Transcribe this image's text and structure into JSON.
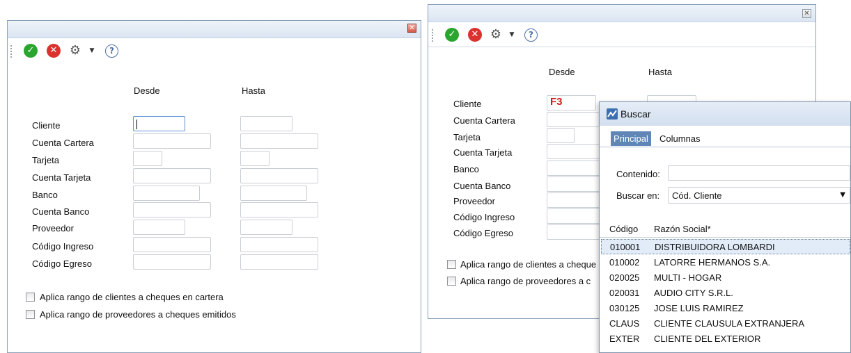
{
  "left_form": {
    "close_icon": "close-x-red",
    "toolbar": {
      "accept_icon": "check-circle-icon",
      "cancel_icon": "cancel-circle-icon",
      "settings_icon": "gear-icon",
      "dropdown_icon": "chevron-down-icon",
      "help_icon": "help-icon"
    },
    "col_desde": "Desde",
    "col_hasta": "Hasta",
    "fields": [
      {
        "label": "Cliente"
      },
      {
        "label": "Cuenta Cartera"
      },
      {
        "label": "Tarjeta"
      },
      {
        "label": "Cuenta Tarjeta"
      },
      {
        "label": "Banco"
      },
      {
        "label": "Cuenta Banco"
      },
      {
        "label": "Proveedor"
      },
      {
        "label": "Código Ingreso"
      },
      {
        "label": "Código Egreso"
      }
    ],
    "checkboxes": [
      {
        "label": "Aplica rango de clientes a cheques en cartera",
        "checked": false
      },
      {
        "label": "Aplica rango de proveedores a cheques emitidos",
        "checked": false
      }
    ]
  },
  "right_form": {
    "col_desde": "Desde",
    "col_hasta": "Hasta",
    "hint_key": "F3",
    "fields": [
      {
        "label": "Cliente"
      },
      {
        "label": "Cuenta Cartera"
      },
      {
        "label": "Tarjeta"
      },
      {
        "label": "Cuenta Tarjeta"
      },
      {
        "label": "Banco"
      },
      {
        "label": "Cuenta Banco"
      },
      {
        "label": "Proveedor"
      },
      {
        "label": "Código Ingreso"
      },
      {
        "label": "Código Egreso"
      }
    ],
    "checkboxes": [
      {
        "label": "Aplica rango de clientes a cheque",
        "checked": false
      },
      {
        "label": "Aplica rango de proveedores a c",
        "checked": false
      }
    ]
  },
  "search_dialog": {
    "title": "Buscar",
    "title_icon": "chart-app-icon",
    "tabs": [
      {
        "label": "Principal",
        "active": true
      },
      {
        "label": "Columnas",
        "active": false
      }
    ],
    "contenido_label": "Contenido:",
    "contenido_value": "",
    "buscar_en_label": "Buscar en:",
    "buscar_en_value": "Cód. Cliente",
    "columns": [
      "Código",
      "Razón Social*"
    ],
    "rows": [
      {
        "code": "010001",
        "name": "DISTRIBUIDORA LOMBARDI",
        "selected": true
      },
      {
        "code": "010002",
        "name": "LATORRE HERMANOS S.A.",
        "selected": false
      },
      {
        "code": "020025",
        "name": "MULTI - HOGAR",
        "selected": false
      },
      {
        "code": "020031",
        "name": "AUDIO CITY S.R.L.",
        "selected": false
      },
      {
        "code": "030125",
        "name": "JOSE LUIS RAMIREZ",
        "selected": false
      },
      {
        "code": "CLAUS",
        "name": "CLIENTE CLAUSULA EXTRANJERA",
        "selected": false
      },
      {
        "code": "EXTER",
        "name": "CLIENTE DEL EXTERIOR",
        "selected": false
      }
    ]
  },
  "colors": {
    "accent": "#5f86b7",
    "hint_red": "#d31b1b",
    "ok_green": "#2aa52f",
    "cancel_red": "#d9322f"
  }
}
